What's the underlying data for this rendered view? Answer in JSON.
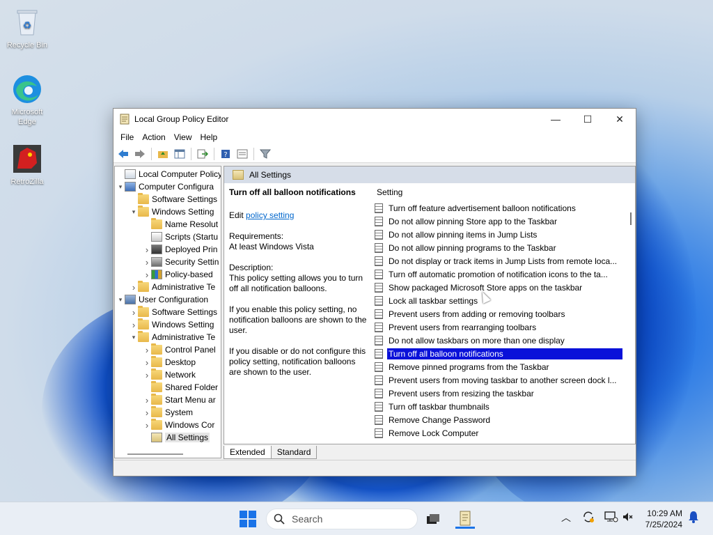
{
  "desktop": {
    "icons": [
      {
        "label": "Recycle Bin",
        "icon": "recycle-bin-icon"
      },
      {
        "label": "Microsoft Edge",
        "icon": "edge-icon"
      },
      {
        "label": "RetroZilla",
        "icon": "retrozilla-icon"
      }
    ]
  },
  "window": {
    "title": "Local Group Policy Editor",
    "controls": {
      "minimize": "—",
      "maximize": "☐",
      "close": "✕"
    },
    "menu": [
      "File",
      "Action",
      "View",
      "Help"
    ]
  },
  "tree": {
    "items": [
      {
        "label": "Local Computer Policy",
        "icon": "computer-policy-icon",
        "level": 0,
        "chevron": ""
      },
      {
        "label": "Computer Configura",
        "icon": "computer-icon",
        "level": 0,
        "chevron": "down"
      },
      {
        "label": "Software Settings",
        "icon": "folder-icon",
        "level": 1,
        "chevron": ""
      },
      {
        "label": "Windows Setting",
        "icon": "folder-icon",
        "level": 1,
        "chevron": "down"
      },
      {
        "label": "Name Resolut",
        "icon": "folder-icon",
        "level": 2,
        "chevron": ""
      },
      {
        "label": "Scripts (Startu",
        "icon": "scripts-icon",
        "level": 2,
        "chevron": ""
      },
      {
        "label": "Deployed Prin",
        "icon": "printer-icon",
        "level": 2,
        "chevron": "right"
      },
      {
        "label": "Security Settin",
        "icon": "security-icon",
        "level": 2,
        "chevron": "right"
      },
      {
        "label": "Policy-based",
        "icon": "chart-icon",
        "level": 2,
        "chevron": "right"
      },
      {
        "label": "Administrative Te",
        "icon": "folder-icon",
        "level": 1,
        "chevron": "right"
      },
      {
        "label": "User Configuration",
        "icon": "user-icon",
        "level": 0,
        "chevron": "down"
      },
      {
        "label": "Software Settings",
        "icon": "folder-icon",
        "level": 1,
        "chevron": "right"
      },
      {
        "label": "Windows Setting",
        "icon": "folder-icon",
        "level": 1,
        "chevron": "right"
      },
      {
        "label": "Administrative Te",
        "icon": "folder-icon",
        "level": 1,
        "chevron": "down"
      },
      {
        "label": "Control Panel",
        "icon": "folder-icon",
        "level": 2,
        "chevron": "right"
      },
      {
        "label": "Desktop",
        "icon": "folder-icon",
        "level": 2,
        "chevron": "right"
      },
      {
        "label": "Network",
        "icon": "folder-icon",
        "level": 2,
        "chevron": "right"
      },
      {
        "label": "Shared Folder",
        "icon": "folder-icon",
        "level": 2,
        "chevron": ""
      },
      {
        "label": "Start Menu ar",
        "icon": "folder-icon",
        "level": 2,
        "chevron": "right"
      },
      {
        "label": "System",
        "icon": "folder-icon",
        "level": 2,
        "chevron": "right"
      },
      {
        "label": "Windows Cor",
        "icon": "folder-icon",
        "level": 2,
        "chevron": "right"
      },
      {
        "label": "All Settings",
        "icon": "all-settings-icon",
        "level": 2,
        "chevron": "",
        "selected": true
      }
    ]
  },
  "right_pane": {
    "header": "All Settings",
    "description": {
      "title": "Turn off all balloon notifications",
      "edit_prefix": "Edit",
      "edit_link": "policy setting",
      "requirements_label": "Requirements:",
      "requirements_value": "At least Windows Vista",
      "description_label": "Description:",
      "description_text": "This policy setting allows you to turn off all notification balloons.",
      "enable_text": "If you enable this policy setting, no notification balloons are shown to the user.",
      "disable_text": "If you disable or do not configure this policy setting, notification balloons are shown to the user."
    },
    "column_header": "Setting",
    "settings": [
      "Turn off feature advertisement balloon notifications",
      "Do not allow pinning Store app to the Taskbar",
      "Do not allow pinning items in Jump Lists",
      "Do not allow pinning programs to the Taskbar",
      "Do not display or track items in Jump Lists from remote loca...",
      "Turn off automatic promotion of notification icons to the ta...",
      "Show packaged Microsoft Store apps on the taskbar",
      "Lock all taskbar settings",
      "Prevent users from adding or removing toolbars",
      "Prevent users from rearranging toolbars",
      "Do not allow taskbars on more than one display",
      "Turn off all balloon notifications",
      "Remove pinned programs from the Taskbar",
      "Prevent users from moving taskbar to another screen dock l...",
      "Prevent users from resizing the taskbar",
      "Turn off taskbar thumbnails",
      "Remove Change Password",
      "Remove Lock Computer"
    ],
    "selected_index": 11,
    "tabs": [
      "Extended",
      "Standard"
    ],
    "active_tab": "Extended"
  },
  "taskbar": {
    "search_placeholder": "Search",
    "clock_time": "10:29 AM",
    "clock_date": "7/25/2024"
  },
  "colors": {
    "selection": "#0a11d9",
    "accent": "#1a73e8"
  }
}
